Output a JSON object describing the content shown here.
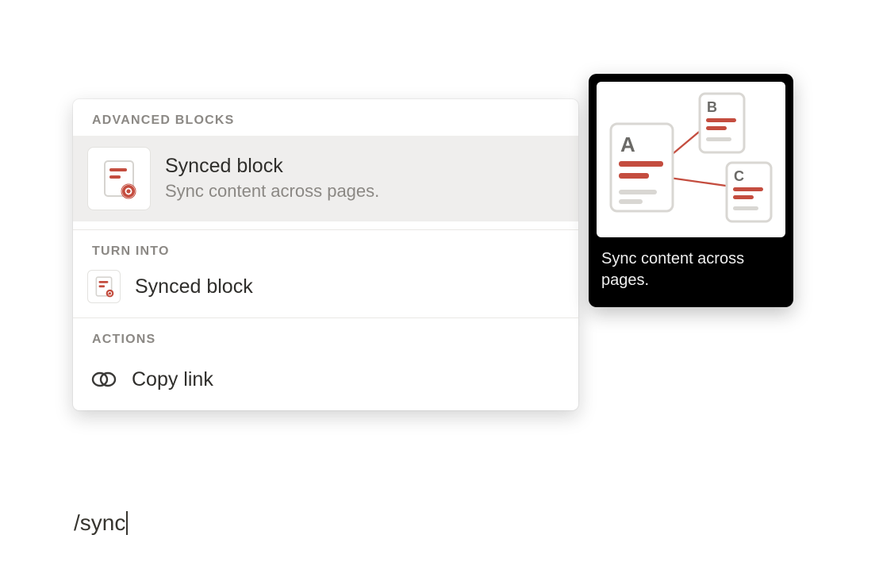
{
  "input": {
    "text": "/sync"
  },
  "sections": {
    "advanced_blocks": {
      "header": "ADVANCED BLOCKS",
      "item": {
        "title": "Synced block",
        "subtitle": "Sync content across pages."
      }
    },
    "turn_into": {
      "header": "TURN INTO",
      "item": {
        "title": "Synced block"
      }
    },
    "actions": {
      "header": "ACTIONS",
      "item": {
        "title": "Copy link"
      }
    }
  },
  "preview": {
    "caption": "Sync content across pages.",
    "labels": {
      "a": "A",
      "b": "B",
      "c": "C"
    }
  }
}
